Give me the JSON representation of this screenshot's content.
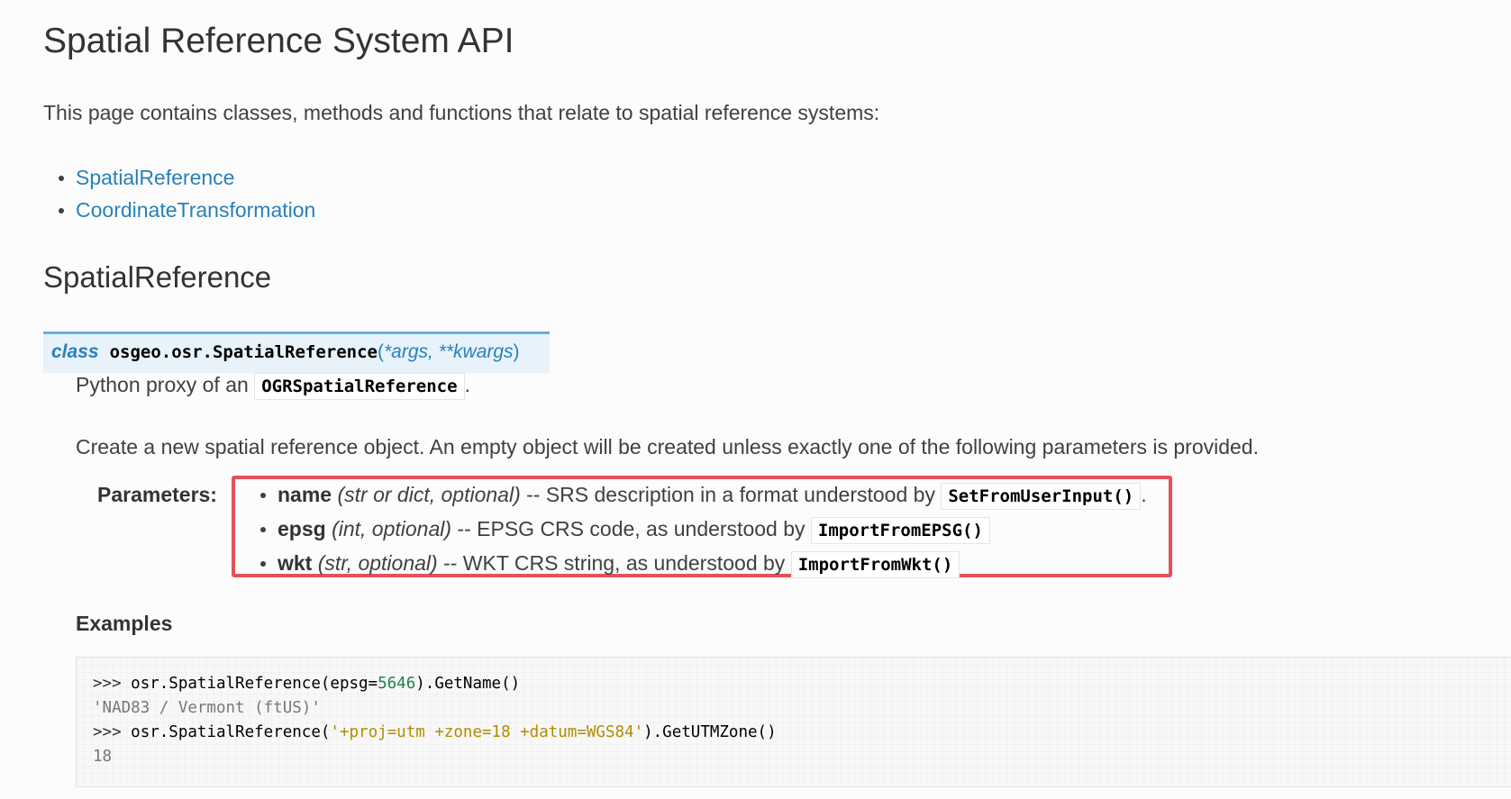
{
  "page": {
    "title": "Spatial Reference System API",
    "intro": "This page contains classes, methods and functions that relate to spatial reference systems:"
  },
  "toc": [
    {
      "label": "SpatialReference"
    },
    {
      "label": "CoordinateTransformation"
    }
  ],
  "section": {
    "heading": "SpatialReference"
  },
  "signature": {
    "keyword": "class",
    "name": "osgeo.osr.SpatialReference",
    "open_paren": "(",
    "params": "*args, **kwargs",
    "close_paren": ")"
  },
  "description": {
    "proxy_text": "Python proxy of an",
    "proxy_code": "OGRSpatialReference",
    "proxy_end": ".",
    "create_text": "Create a new spatial reference object. An empty object will be created unless exactly one of the following parameters is provided."
  },
  "parameters": {
    "label": "Parameters:",
    "highlight_color": "#e5515b",
    "items": [
      {
        "name": "name",
        "type": "(str or dict, optional)",
        "text": " -- SRS description in a format understood by ",
        "code": "SetFromUserInput()",
        "end": "."
      },
      {
        "name": "epsg",
        "type": "(int, optional)",
        "text": " -- EPSG CRS code, as understood by ",
        "code": "ImportFromEPSG()",
        "end": ""
      },
      {
        "name": "wkt",
        "type": "(str, optional)",
        "text": " -- WKT CRS string, as understood by ",
        "code": "ImportFromWkt()",
        "end": ""
      }
    ]
  },
  "examples": {
    "heading": "Examples",
    "lines": {
      "l1_prompt": ">>> ",
      "l1_a": "osr.SpatialReference(epsg=",
      "l1_num": "5646",
      "l1_b": ").GetName()",
      "l2_output": "'NAD83 / Vermont (ftUS)'",
      "l3_prompt": ">>> ",
      "l3_a": "osr.SpatialReference(",
      "l3_str": "'+proj=utm +zone=18 +datum=WGS84'",
      "l3_b": ").GetUTMZone()",
      "l4_output": "18"
    }
  }
}
